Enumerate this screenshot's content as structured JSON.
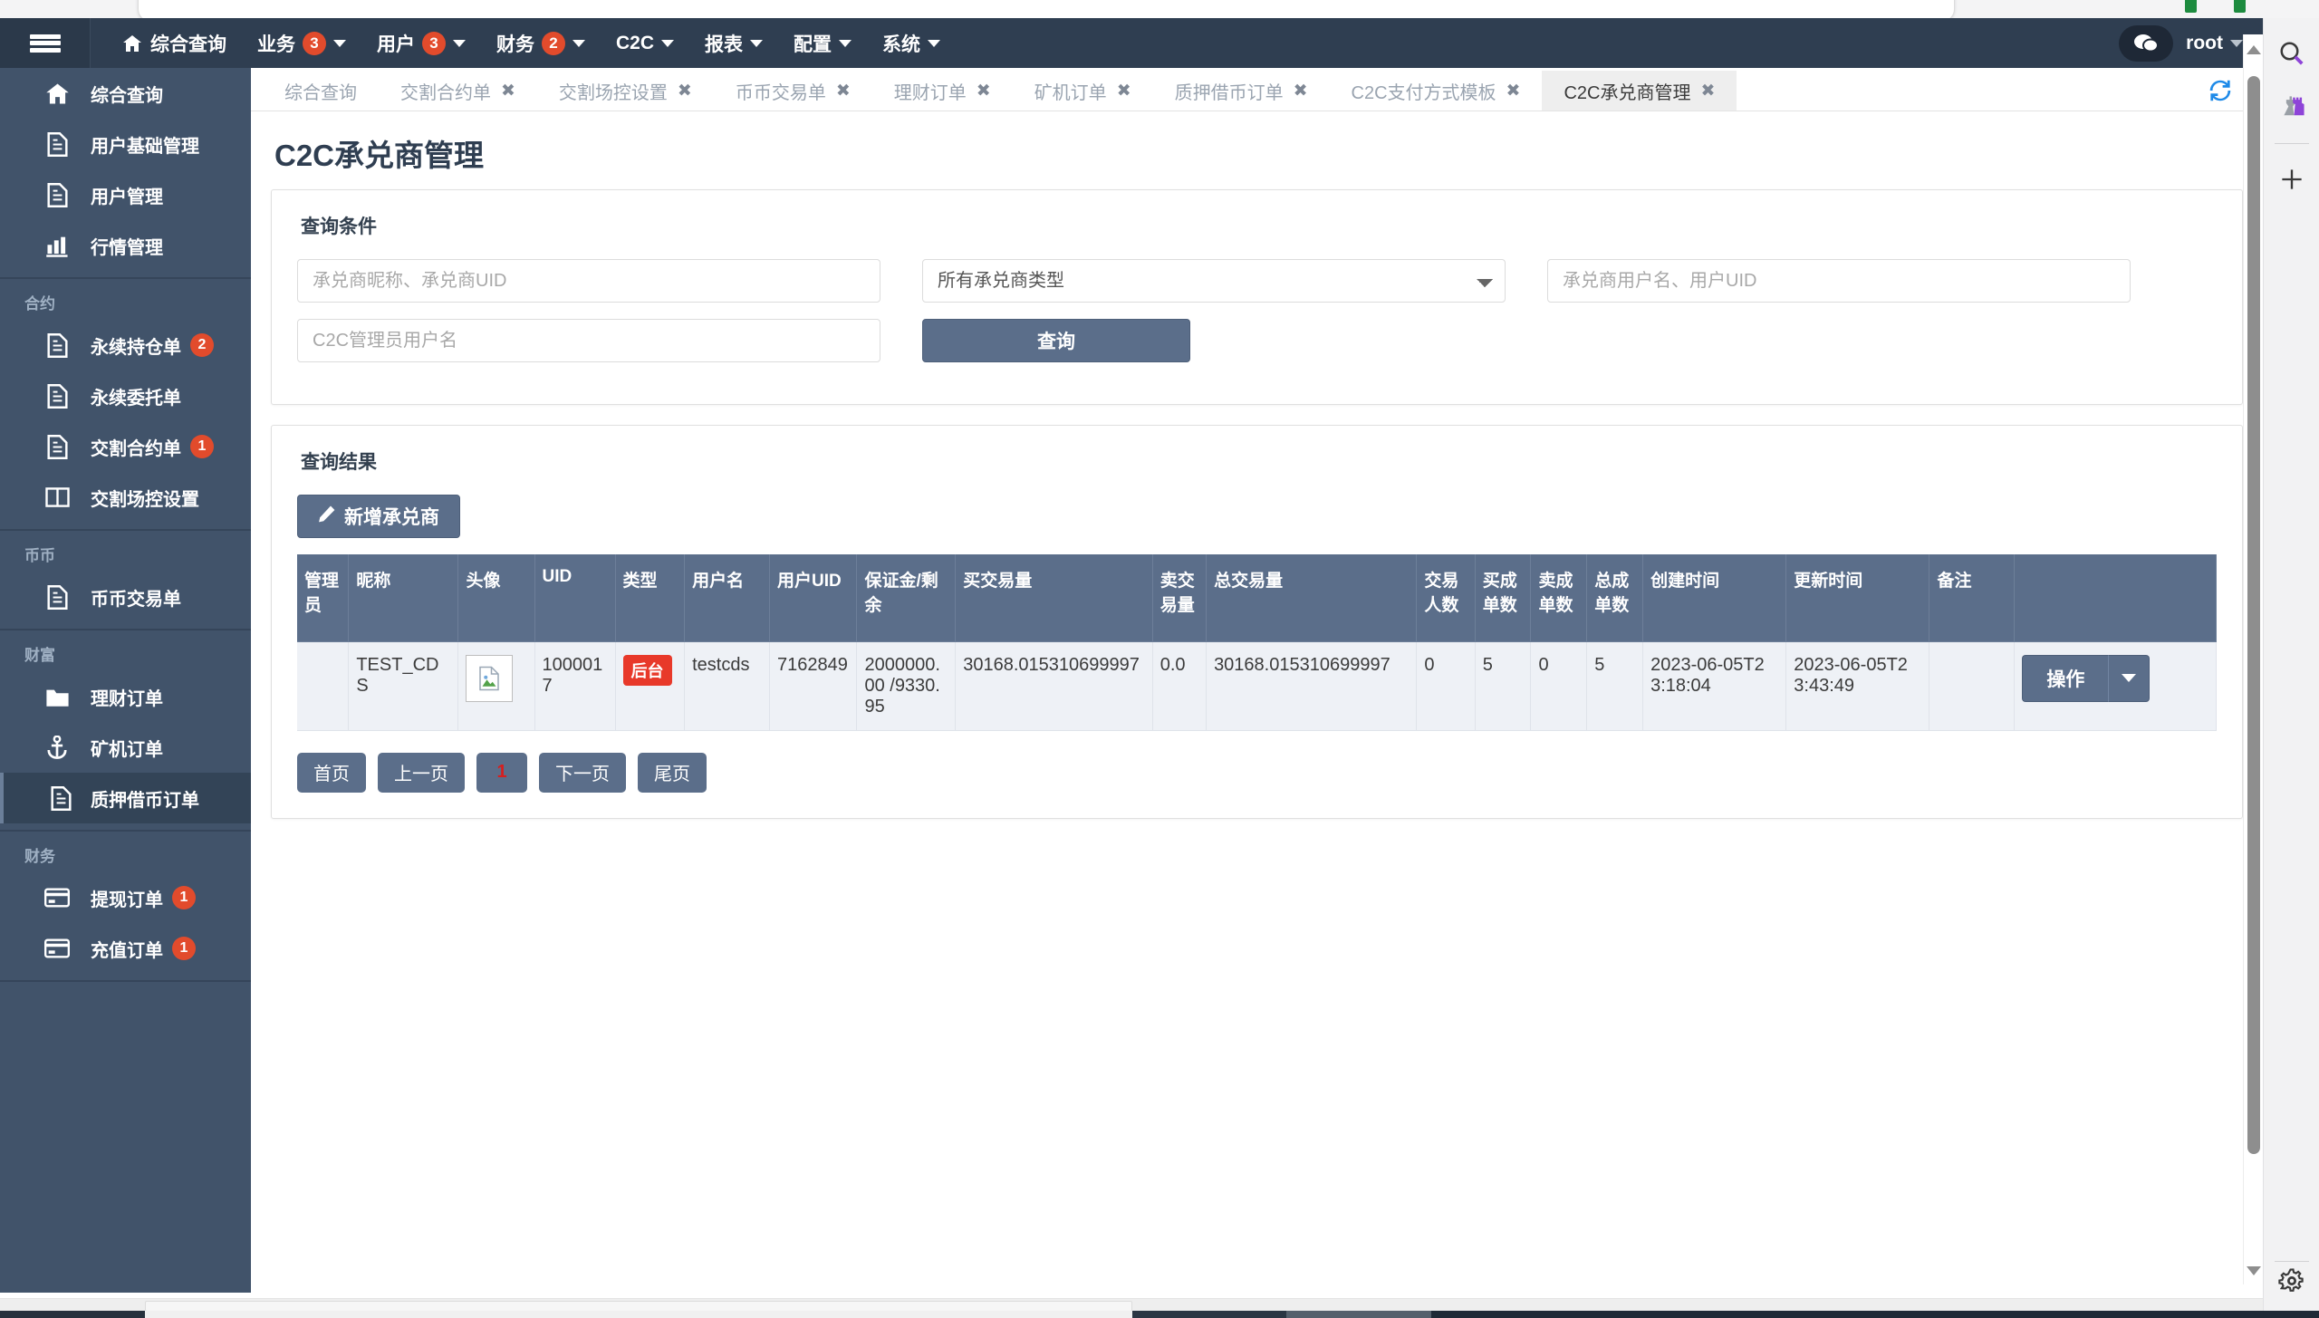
{
  "topnav": {
    "hamburger_icon": "hamburger-menu-icon",
    "items": [
      {
        "label": "综合查询",
        "icon": "home-icon",
        "badge": null,
        "caret": false
      },
      {
        "label": "业务",
        "icon": null,
        "badge": "3",
        "caret": true
      },
      {
        "label": "用户",
        "icon": null,
        "badge": "3",
        "caret": true
      },
      {
        "label": "财务",
        "icon": null,
        "badge": "2",
        "caret": true
      },
      {
        "label": "C2C",
        "icon": null,
        "badge": null,
        "caret": true
      },
      {
        "label": "报表",
        "icon": null,
        "badge": null,
        "caret": true
      },
      {
        "label": "配置",
        "icon": null,
        "badge": null,
        "caret": true
      },
      {
        "label": "系统",
        "icon": null,
        "badge": null,
        "caret": true
      }
    ],
    "chat_icon": "chat-bubbles-icon",
    "username": "root"
  },
  "sidebar": {
    "groups": [
      {
        "title": null,
        "items": [
          {
            "label": "综合查询",
            "icon": "home-icon",
            "badge": null,
            "active": false
          },
          {
            "label": "用户基础管理",
            "icon": "document-icon",
            "badge": null,
            "active": false
          },
          {
            "label": "用户管理",
            "icon": "document-icon",
            "badge": null,
            "active": false
          },
          {
            "label": "行情管理",
            "icon": "bar-chart-icon",
            "badge": null,
            "active": false
          }
        ]
      },
      {
        "title": "合约",
        "items": [
          {
            "label": "永续持仓单",
            "icon": "document-icon",
            "badge": "2",
            "active": false
          },
          {
            "label": "永续委托单",
            "icon": "document-icon",
            "badge": null,
            "active": false
          },
          {
            "label": "交割合约单",
            "icon": "document-icon",
            "badge": "1",
            "active": false
          },
          {
            "label": "交割场控设置",
            "icon": "columns-icon",
            "badge": null,
            "active": false
          }
        ]
      },
      {
        "title": "币币",
        "items": [
          {
            "label": "币币交易单",
            "icon": "document-icon",
            "badge": null,
            "active": false
          }
        ]
      },
      {
        "title": "财富",
        "items": [
          {
            "label": "理财订单",
            "icon": "folder-icon",
            "badge": null,
            "active": false
          },
          {
            "label": "矿机订单",
            "icon": "anchor-icon",
            "badge": null,
            "active": false
          },
          {
            "label": "质押借币订单",
            "icon": "document-icon",
            "badge": null,
            "active": true
          }
        ]
      },
      {
        "title": "财务",
        "items": [
          {
            "label": "提现订单",
            "icon": "credit-card-icon",
            "badge": "1",
            "active": false
          },
          {
            "label": "充值订单",
            "icon": "credit-card-icon",
            "badge": "1",
            "active": false
          }
        ]
      }
    ]
  },
  "tabs": [
    {
      "label": "综合查询",
      "closable": false,
      "active": false
    },
    {
      "label": "交割合约单",
      "closable": true,
      "active": false
    },
    {
      "label": "交割场控设置",
      "closable": true,
      "active": false
    },
    {
      "label": "币币交易单",
      "closable": true,
      "active": false
    },
    {
      "label": "理财订单",
      "closable": true,
      "active": false
    },
    {
      "label": "矿机订单",
      "closable": true,
      "active": false
    },
    {
      "label": "质押借币订单",
      "closable": true,
      "active": false
    },
    {
      "label": "C2C支付方式模板",
      "closable": true,
      "active": false
    },
    {
      "label": "C2C承兑商管理",
      "closable": true,
      "active": true
    }
  ],
  "refresh_icon": "refresh-icon",
  "page": {
    "title": "C2C承兑商管理"
  },
  "query_panel": {
    "title": "查询条件",
    "merchant_placeholder": "承兑商昵称、承兑商UID",
    "type_selected": "所有承兑商类型",
    "type_options": [
      "所有承兑商类型"
    ],
    "user_placeholder": "承兑商用户名、用户UID",
    "admin_placeholder": "C2C管理员用户名",
    "query_button": "查询"
  },
  "result_panel": {
    "title": "查询结果",
    "add_button": "新增承兑商",
    "add_icon": "pencil-icon",
    "columns": [
      "管理员",
      "昵称",
      "头像",
      "UID",
      "类型",
      "用户名",
      "用户UID",
      "保证金/剩余",
      "买交易量",
      "卖交易量",
      "总交易量",
      "交易人数",
      "买成单数",
      "卖成单数",
      "总成单数",
      "创建时间",
      "更新时间",
      "备注",
      ""
    ],
    "rows": [
      {
        "admin": "",
        "nickname": "TEST_CDS",
        "avatar_icon": "broken-image-icon",
        "uid": "1000017",
        "type": "后台",
        "username": "testcds",
        "user_uid": "7162849",
        "margin": "2000000.00 /9330.95",
        "buy_volume": "30168.015310699997",
        "sell_volume": "0.0",
        "total_volume": "30168.015310699997",
        "trade_people": "0",
        "buy_orders": "5",
        "sell_orders": "0",
        "total_orders": "5",
        "created_at": "2023-06-05T23:18:04",
        "updated_at": "2023-06-05T23:43:49",
        "note": "",
        "action_label": "操作",
        "action_caret_icon": "caret-down-icon"
      }
    ]
  },
  "pager": {
    "first": "首页",
    "prev": "上一页",
    "current": "1",
    "next": "下一页",
    "last": "尾页"
  },
  "right_rail": {
    "search_icon": "search-icon",
    "chess_icon": "chess-pieces-icon",
    "plus_icon": "plus-icon",
    "gear_icon": "gear-icon"
  },
  "colors": {
    "navbar": "#2f3e51",
    "sidebar": "#41536a",
    "accent": "#5b6e8a",
    "badge_red": "#e24b2c",
    "type_red": "#e8392a",
    "page_red": "#d61f1f"
  }
}
